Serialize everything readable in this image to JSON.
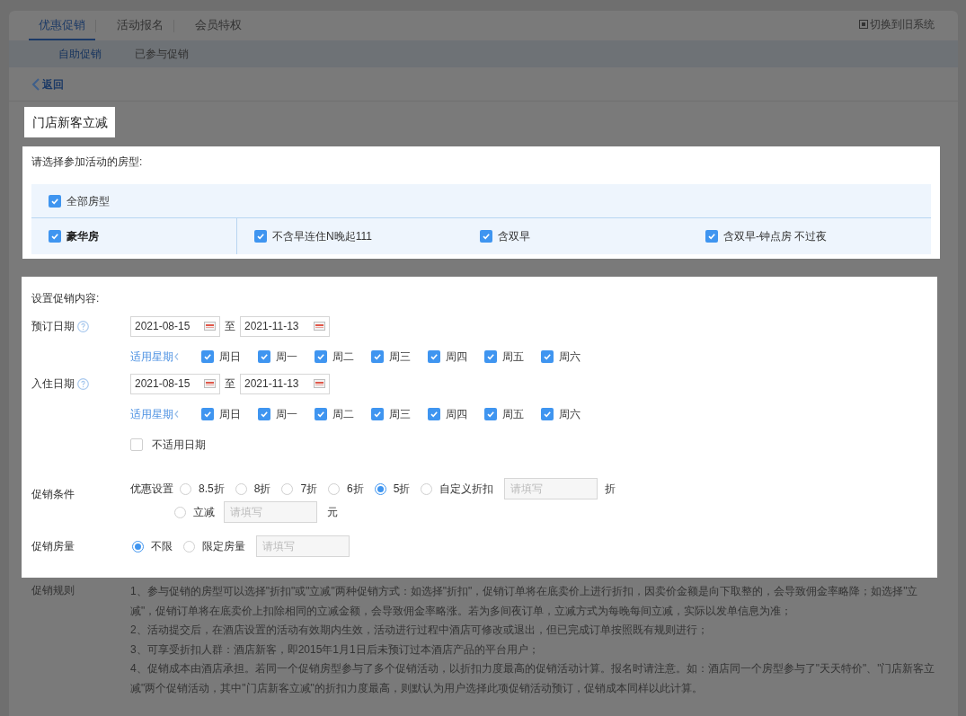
{
  "top_tabs": [
    {
      "label": "优惠促销",
      "selected": true
    },
    {
      "label": "活动报名",
      "selected": false
    },
    {
      "label": "会员特权",
      "selected": false
    }
  ],
  "switch_link": "切换到旧系统",
  "sub_tabs": [
    {
      "label": "自助促销",
      "selected": true
    },
    {
      "label": "已参与促销",
      "selected": false
    }
  ],
  "back": "返回",
  "title": "门店新客立减",
  "room_section": {
    "prompt": "请选择参加活动的房型:",
    "all": {
      "label": "全部房型",
      "checked": true
    },
    "room": {
      "label": "豪华房",
      "checked": true
    },
    "rate_plans": [
      {
        "label": "不含早连住N晚起111",
        "checked": true
      },
      {
        "label": "含双早",
        "checked": true
      },
      {
        "label": "含双早-钟点房 不过夜",
        "checked": true
      }
    ]
  },
  "promo": {
    "heading": "设置促销内容:",
    "date_rows": [
      {
        "label": "预订日期",
        "start": "2021-08-15",
        "separator": "至",
        "end": "2021-11-13",
        "weekdays_label": "适用星期",
        "weekdays": [
          {
            "label": "周日",
            "checked": true
          },
          {
            "label": "周一",
            "checked": true
          },
          {
            "label": "周二",
            "checked": true
          },
          {
            "label": "周三",
            "checked": true
          },
          {
            "label": "周四",
            "checked": true
          },
          {
            "label": "周五",
            "checked": true
          },
          {
            "label": "周六",
            "checked": true
          }
        ]
      },
      {
        "label": "入住日期",
        "start": "2021-08-15",
        "separator": "至",
        "end": "2021-11-13",
        "weekdays_label": "适用星期",
        "weekdays": [
          {
            "label": "周日",
            "checked": true
          },
          {
            "label": "周一",
            "checked": true
          },
          {
            "label": "周二",
            "checked": true
          },
          {
            "label": "周三",
            "checked": true
          },
          {
            "label": "周四",
            "checked": true
          },
          {
            "label": "周五",
            "checked": true
          },
          {
            "label": "周六",
            "checked": true
          }
        ]
      }
    ],
    "exclude": {
      "label": "不适用日期",
      "checked": false
    },
    "condition": {
      "label": "促销条件",
      "setting_label": "优惠设置",
      "options": [
        {
          "label": "8.5折",
          "selected": false
        },
        {
          "label": "8折",
          "selected": false
        },
        {
          "label": "7折",
          "selected": false
        },
        {
          "label": "6折",
          "selected": false
        },
        {
          "label": "5折",
          "selected": true
        },
        {
          "label": "自定义折扣",
          "selected": false
        }
      ],
      "custom_placeholder": "请填写",
      "custom_unit": "折",
      "reduce": {
        "label": "立减",
        "selected": false
      },
      "reduce_placeholder": "请填写",
      "reduce_unit": "元"
    },
    "quantity": {
      "label": "促销房量",
      "options": [
        {
          "label": "不限",
          "selected": true
        },
        {
          "label": "限定房量",
          "selected": false
        }
      ],
      "placeholder": "请填写"
    }
  },
  "rules": {
    "label": "促销规则",
    "items": [
      "1、参与促销的房型可以选择\"折扣\"或\"立减\"两种促销方式：如选择\"折扣\"，促销订单将在底卖价上进行折扣，因卖价金额是向下取整的，会导致佣金率略降；如选择\"立减\"，促销订单将在底卖价上扣除相同的立减金额，会导致佣金率略涨。若为多间夜订单，立减方式为每晚每间立减，实际以发单信息为准；",
      "2、活动提交后，在酒店设置的活动有效期内生效，活动进行过程中酒店可修改或退出，但已完成订单按照既有规则进行；",
      "3、可享受折扣人群：酒店新客，即2015年1月1日后未预订过本酒店产品的平台用户；",
      "4、促销成本由酒店承担。若同一个促销房型参与了多个促销活动，以折扣力度最高的促销活动计算。报名时请注意。如：酒店同一个房型参与了\"天天特价\"、\"门店新客立减\"两个促销活动，其中\"门店新客立减\"的折扣力度最高，则默认为用户选择此项促销活动预订，促销成本同样以此计算。"
    ]
  }
}
